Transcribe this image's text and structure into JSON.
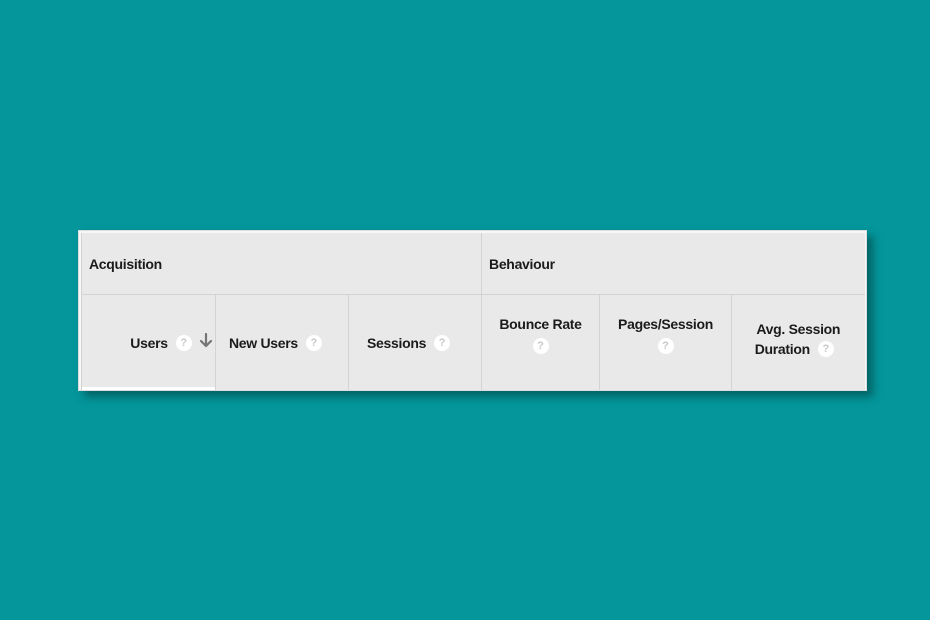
{
  "table_header": {
    "groups": [
      {
        "label": "Acquisition",
        "columns": 3
      },
      {
        "label": "Behaviour",
        "columns": 3
      }
    ],
    "columns": [
      {
        "label": "Users",
        "help_icon": "question-circle-icon",
        "sort": "descending",
        "sort_icon": "arrow-down-icon",
        "selected": true
      },
      {
        "label": "New Users",
        "help_icon": "question-circle-icon"
      },
      {
        "label": "Sessions",
        "help_icon": "question-circle-icon"
      },
      {
        "label": "Bounce Rate",
        "help_icon": "question-circle-icon"
      },
      {
        "label": "Pages/Session",
        "help_icon": "question-circle-icon"
      },
      {
        "label_line1": "Avg. Session",
        "label_line2": "Duration",
        "help_icon": "question-circle-icon"
      }
    ],
    "help_glyph": "?"
  },
  "colors": {
    "background": "#04969b",
    "header_fill": "#e9e9e9",
    "border": "#d3d3d3",
    "text": "#1b1b1b",
    "sort_arrow": "#757575"
  }
}
